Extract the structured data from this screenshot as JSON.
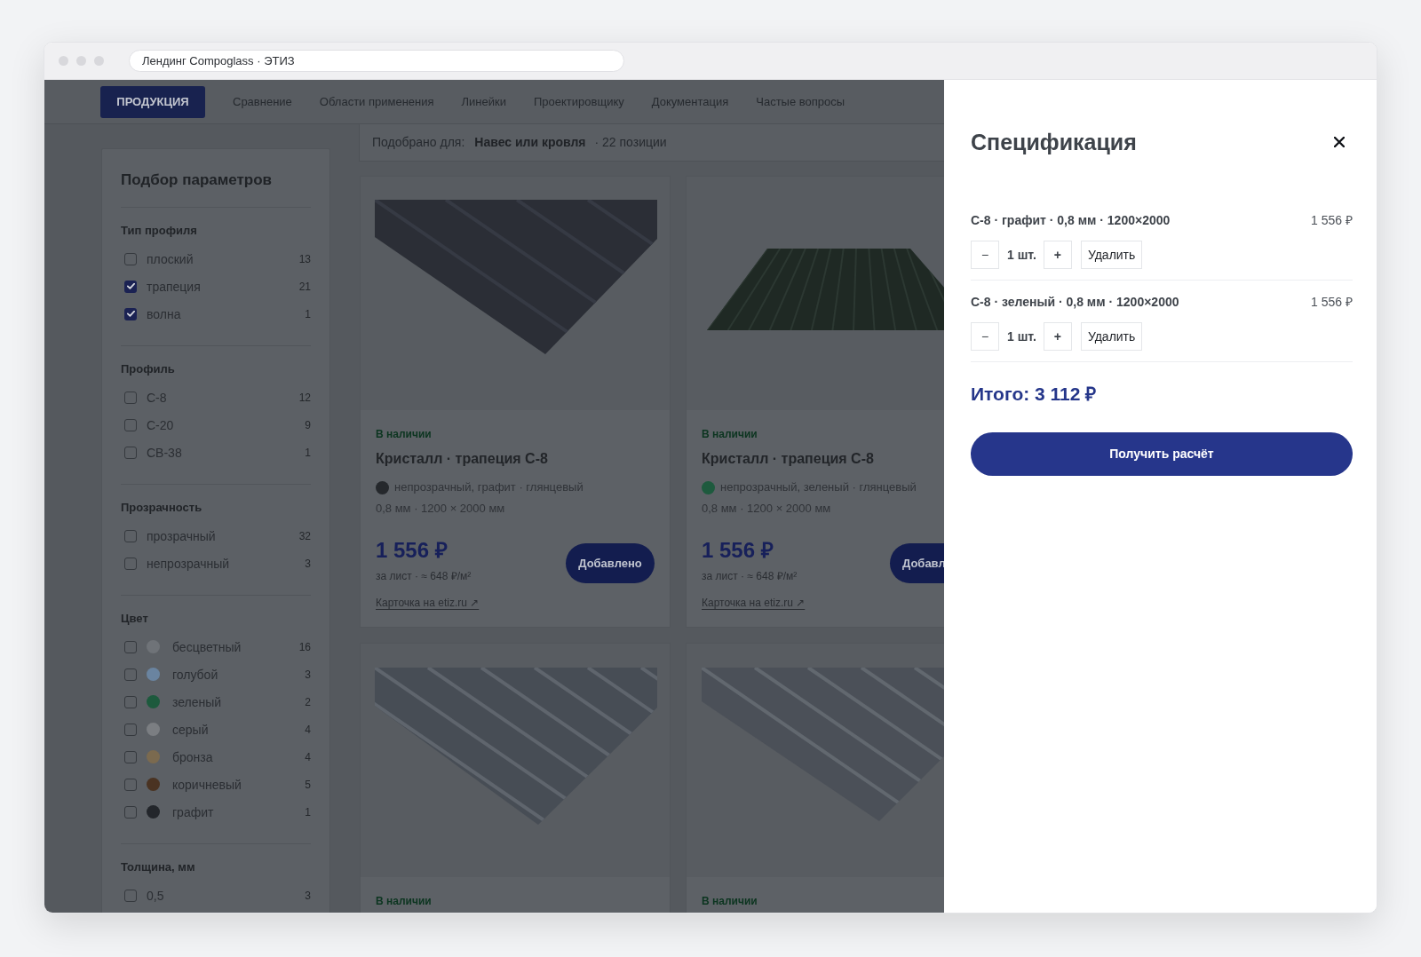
{
  "browser": {
    "address": "Лендинг Compoglass · ЭТИЗ"
  },
  "nav": [
    {
      "label": "ПРОДУКЦИЯ",
      "selected": true
    },
    {
      "label": "Сравнение",
      "selected": false
    },
    {
      "label": "Области применения",
      "selected": false
    },
    {
      "label": "Линейки",
      "selected": false
    },
    {
      "label": "Проектировщику",
      "selected": false
    },
    {
      "label": "Документация",
      "selected": false
    },
    {
      "label": "Частые вопросы",
      "selected": false
    }
  ],
  "filters": {
    "title": "Подбор параметров",
    "groups": [
      {
        "title": "Тип профиля",
        "options": [
          {
            "label": "плоский",
            "count": "13",
            "checked": false
          },
          {
            "label": "трапеция",
            "count": "21",
            "checked": true
          },
          {
            "label": "волна",
            "count": "1",
            "checked": true
          }
        ]
      },
      {
        "title": "Профиль",
        "options": [
          {
            "label": "С-8",
            "count": "12",
            "checked": false
          },
          {
            "label": "С-20",
            "count": "9",
            "checked": false
          },
          {
            "label": "СВ-38",
            "count": "1",
            "checked": false
          }
        ]
      },
      {
        "title": "Прозрачность",
        "options": [
          {
            "label": "прозрачный",
            "count": "32",
            "checked": false
          },
          {
            "label": "непрозрачный",
            "count": "3",
            "checked": false
          }
        ]
      },
      {
        "title": "Цвет",
        "options": [
          {
            "label": "бесцветный",
            "count": "16",
            "checked": false,
            "color": "#6f7378"
          },
          {
            "label": "голубой",
            "count": "3",
            "checked": false,
            "color": "#6a84a0"
          },
          {
            "label": "зеленый",
            "count": "2",
            "checked": false,
            "color": "#1d5a3d"
          },
          {
            "label": "серый",
            "count": "4",
            "checked": false,
            "color": "#7b7e82"
          },
          {
            "label": "бронза",
            "count": "4",
            "checked": false,
            "color": "#7b6a4f"
          },
          {
            "label": "коричневый",
            "count": "5",
            "checked": false,
            "color": "#4a3322"
          },
          {
            "label": "графит",
            "count": "1",
            "checked": false,
            "color": "#23262b"
          }
        ]
      },
      {
        "title": "Толщина, мм",
        "options": [
          {
            "label": "0,5",
            "count": "3",
            "checked": false
          }
        ]
      }
    ]
  },
  "results_bar": {
    "label": "Подобрано для:",
    "value": "Навес или кровля",
    "count": "· 22 позиции"
  },
  "products": [
    {
      "status": "В наличии",
      "title": "Кристалл · трапеция С-8",
      "color": "#25282c",
      "spec": "непрозрачный, графит · глянцевый",
      "dims": "0,8 мм · 1200 × 2000 мм",
      "price": "1 556 ₽",
      "unit": "за лист · ≈ 648 ₽/м²",
      "button": "Добавлено",
      "link": "Карточка на etiz.ru ↗"
    },
    {
      "status": "В наличии",
      "title": "Кристалл · трапеция С-8",
      "color": "#1e5a3e",
      "spec": "непрозрачный, зеленый · глянцевый",
      "dims": "0,8 мм · 1200 × 2000 мм",
      "price": "1 556 ₽",
      "unit": "за лист · ≈ 648 ₽/м²",
      "button": "Добавл",
      "link": "Карточка на etiz.ru ↗"
    },
    {
      "status": "В наличии"
    },
    {
      "status": "В наличии"
    }
  ],
  "specification": {
    "title": "Спецификация",
    "items": [
      {
        "name": "С-8 · графит · 0,8 мм · 1200×2000",
        "price": "1 556 ₽",
        "decrement": "−",
        "quantity": "1 шт.",
        "increment": "+",
        "remove": "Удалить"
      },
      {
        "name": "С-8 · зеленый · 0,8 мм · 1200×2000",
        "price": "1 556 ₽",
        "decrement": "−",
        "quantity": "1 шт.",
        "increment": "+",
        "remove": "Удалить"
      }
    ],
    "total": "Итого: 3 112 ₽",
    "submit": "Получить расчёт"
  }
}
